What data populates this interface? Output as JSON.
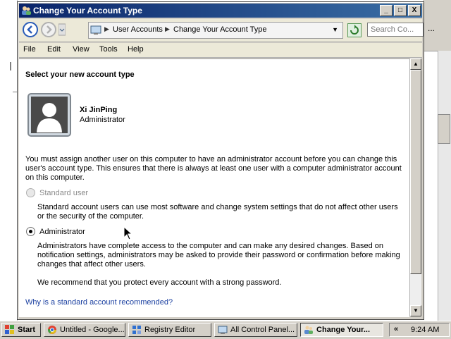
{
  "window": {
    "title": "Change Your Account Type",
    "controls": {
      "minimize": "_",
      "maximize": "□",
      "close": "X"
    }
  },
  "navigation": {
    "breadcrumb": [
      "User Accounts",
      "Change Your Account Type"
    ],
    "search_placeholder": "Search Co...",
    "overflow": "..."
  },
  "menu": [
    "File",
    "Edit",
    "View",
    "Tools",
    "Help"
  ],
  "content": {
    "heading": "Select your new account type",
    "user": {
      "name": "Xi JinPing",
      "role": "Administrator"
    },
    "warning_line1": "You must assign another user on this computer to have an administrator account before you can change this",
    "warning_line2": "user's account type. This ensures that there is always at least one user with a computer administrator account",
    "warning_line3": "on this computer.",
    "options": [
      {
        "label": "Standard user",
        "checked": false,
        "disabled": true,
        "desc_line1": "Standard account users can use most software and change system settings that do not affect other users",
        "desc_line2": "or the security of the computer."
      },
      {
        "label": "Administrator",
        "checked": true,
        "disabled": false,
        "desc_line1": "Administrators have complete access to the computer and can make any desired changes. Based on",
        "desc_line2": "notification settings, administrators may be asked to provide their password or confirmation before making",
        "desc_line3": "changes that affect other users."
      }
    ],
    "recommendation": "We recommend that you protect every account with a strong password.",
    "help_link": "Why is a standard account recommended?"
  },
  "taskbar": {
    "start": "Start",
    "tasks": [
      "Untitled - Google...",
      "Registry Editor",
      "All Control Panel...",
      "Change Your..."
    ],
    "tray_chevron": "«",
    "clock": "9:24 AM"
  },
  "colors": {
    "title_start": "#0a246a",
    "title_end": "#3a6ea5",
    "link": "#1a3fa0"
  }
}
